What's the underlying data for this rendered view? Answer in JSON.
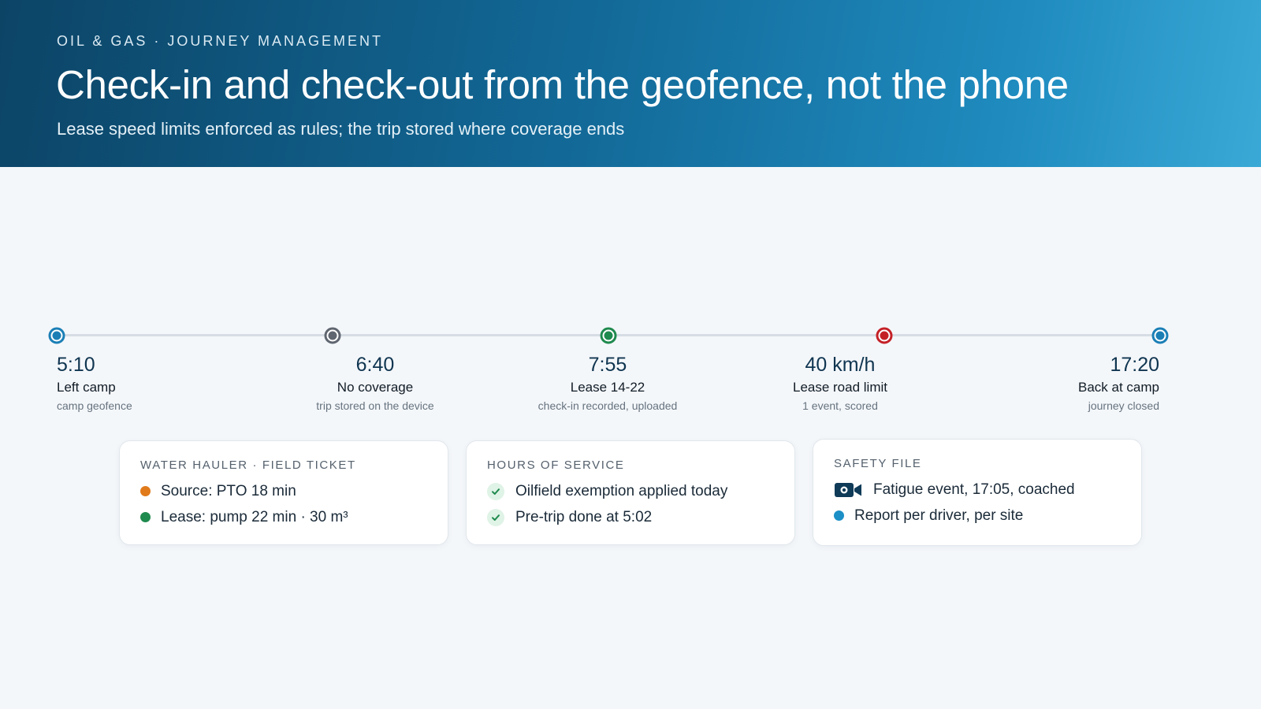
{
  "header": {
    "eyebrow": "OIL & GAS · JOURNEY MANAGEMENT",
    "title": "Check-in and check-out from the geofence, not the phone",
    "subtitle": "Lease speed limits enforced as rules; the trip stored where coverage ends"
  },
  "timeline": {
    "stops": [
      {
        "time": "5:10",
        "label": "Left camp",
        "sub": "camp geofence",
        "color": "#1b7fb6"
      },
      {
        "time": "6:40",
        "label": "No coverage",
        "sub": "trip stored on the device",
        "color": "#5f6670"
      },
      {
        "time": "7:55",
        "label": "Lease 14-22",
        "sub": "check-in recorded, uploaded",
        "color": "#1f8a4e"
      },
      {
        "time": "40 km/h",
        "label": "Lease road limit",
        "sub": "1 event, scored",
        "color": "#c42127"
      },
      {
        "time": "17:20",
        "label": "Back at camp",
        "sub": "journey closed",
        "color": "#1b7fb6"
      }
    ]
  },
  "cards": {
    "ticket": {
      "title": "WATER  HAULER · FIELD TICKET",
      "rows": [
        {
          "text": "Source: PTO 18 min",
          "color": "#e07a1b"
        },
        {
          "text": "Lease: pump 22 min · 30 m³",
          "color": "#1f8a4e"
        }
      ]
    },
    "hos": {
      "title": "HOURS OF SERVICE",
      "rows": [
        {
          "text": "Oilfield exemption  applied today",
          "icon": "check-icon"
        },
        {
          "text": "Pre-trip done at 5:02",
          "icon": "check-icon"
        }
      ]
    },
    "safety": {
      "title": "SAFETY FILE",
      "rows": [
        {
          "text": "Fatigue event, 17:05, coached",
          "icon": "video-camera-icon"
        },
        {
          "text": "Report per driver, per site",
          "color": "#1b8fc6"
        }
      ]
    }
  }
}
